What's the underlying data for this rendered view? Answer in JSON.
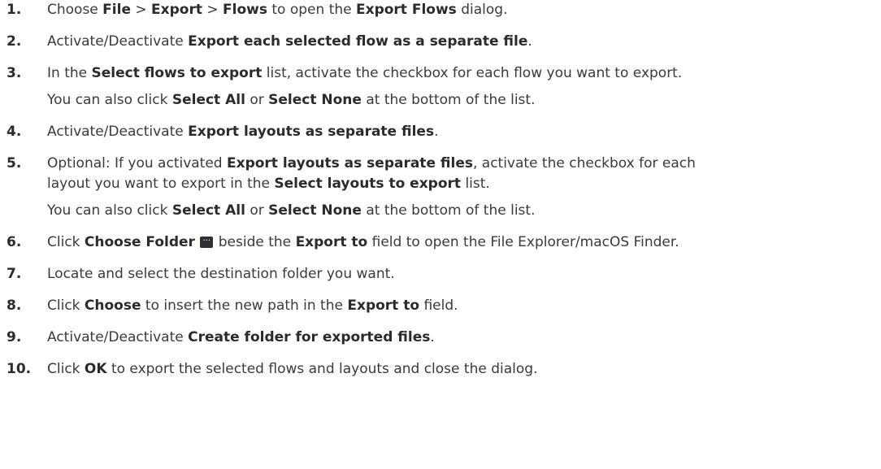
{
  "steps": [
    {
      "num": "1.",
      "parts": [
        "Choose ",
        "File",
        " > ",
        "Export",
        " > ",
        "Flows",
        " to open the ",
        "Export Flows",
        " dialog."
      ]
    },
    {
      "num": "2.",
      "parts": [
        "Activate/Deactivate ",
        "Export each selected flow as a separate file",
        "."
      ]
    },
    {
      "num": "3.",
      "parts": [
        "In the ",
        "Select flows to export",
        " list, activate the checkbox for each flow you want to export."
      ],
      "note": [
        "You can also click ",
        "Select All",
        " or ",
        "Select None",
        " at the bottom of the list."
      ]
    },
    {
      "num": "4.",
      "parts": [
        "Activate/Deactivate ",
        "Export layouts as separate files",
        "."
      ]
    },
    {
      "num": "5.",
      "parts": [
        "Optional: If you activated ",
        "Export layouts as separate files",
        ", activate the checkbox for each"
      ],
      "parts2": [
        "layout you want to export in the ",
        "Select layouts to export",
        " list."
      ],
      "note": [
        "You can also click ",
        "Select All",
        " or ",
        "Select None",
        " at the bottom of the list."
      ]
    },
    {
      "num": "6.",
      "parts": [
        "Click ",
        "Choose Folder",
        " beside the ",
        "Export to",
        " field to open the File Explorer/macOS Finder."
      ],
      "icon": "ellipsis-button-icon"
    },
    {
      "num": "7.",
      "parts": [
        "Locate and select the destination folder you want."
      ]
    },
    {
      "num": "8.",
      "parts": [
        "Click ",
        "Choose",
        " to insert the new path in the ",
        "Export to",
        " field."
      ]
    },
    {
      "num": "9.",
      "parts": [
        "Activate/Deactivate ",
        "Create folder for exported files",
        "."
      ]
    },
    {
      "num": "10.",
      "parts": [
        "Click ",
        "OK",
        " to export the selected flows and layouts and close the dialog."
      ]
    }
  ]
}
